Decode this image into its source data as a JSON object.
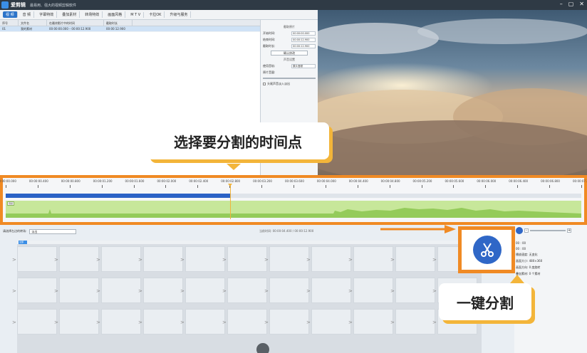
{
  "titlebar": {
    "app_name": "爱剪辑",
    "subtitle": "最易用、强大的视频剪辑软件",
    "min": "–",
    "restore": "▢",
    "close": "✕"
  },
  "menu": {
    "tabs": [
      {
        "label": "视 频",
        "active": true
      },
      {
        "label": "音 频",
        "active": false
      },
      {
        "label": "字幕特效",
        "active": false
      },
      {
        "label": "叠加素材",
        "active": false
      },
      {
        "label": "转场特效",
        "active": false
      },
      {
        "label": "画面风格",
        "active": false
      },
      {
        "label": "M T V",
        "active": false
      },
      {
        "label": "卡拉OK",
        "active": false
      },
      {
        "label": "升级与服务",
        "active": false
      }
    ]
  },
  "filelist": {
    "headers": [
      "序号",
      "文件名",
      "在最终影片中的时间",
      "截取时长"
    ],
    "rows": [
      {
        "index": "01",
        "name": "我的素材",
        "time": "00:00:00.000 – 00:00:12.900",
        "dur": "00:00:12.900"
      }
    ]
  },
  "props": {
    "section1": "截取原片",
    "start_label": "开始时间:",
    "start_value": "00:00:00.000",
    "end_label": "结束时间:",
    "end_value": "00:00:12.900",
    "dur_label": "截取时长:",
    "dur_value": "00:00:12.900",
    "confirm_btn": "确认修改",
    "section2": "声音设置",
    "track_label": "使用音轨:",
    "track_value": "原片音频",
    "vol_label": "原片音量:",
    "vol_hint": "",
    "checkbox_label": "头尾声音淡入淡出"
  },
  "timeline": {
    "ticks": [
      "00:00:00.000",
      "00:00:00.400",
      "00:00:00.800",
      "00:00:01.200",
      "00:00:01.600",
      "00:00:02.000",
      "00:00:02.400",
      "00:00:02.800",
      "00:00:03.200",
      "00:00:03.600",
      "00:00:04.000",
      "00:00:04.400",
      "00:00:04.800",
      "00:00:05.200",
      "00:00:05.600",
      "00:00:06.000",
      "00:00:06.400",
      "00:00:06.800",
      "00:00:07.200"
    ],
    "audio_tag": "音频",
    "playhead_fraction": 0.39,
    "accent": "#f08a24",
    "video_track_color": "#2b62c6",
    "audio_track_color": "#c7e79a"
  },
  "bottom": {
    "transition_label": "请选择左边的转场:",
    "transition_value": "淡出",
    "timecode": "当前时间: 00:00:04.400 / 00:00:12.900",
    "grid_tab": "全部"
  },
  "rightpanel": {
    "lines": [
      "00 : 00",
      "00 : 00",
      "播放速度:  无变化",
      "画面大小:  480×360",
      "画面方向:  0 度旋转",
      "叠加素材:  0 个素材"
    ]
  },
  "callouts": {
    "select_time": "选择要分割的时间点",
    "one_click_split": "一键分割"
  },
  "icons": {
    "split": "scissors-icon"
  }
}
